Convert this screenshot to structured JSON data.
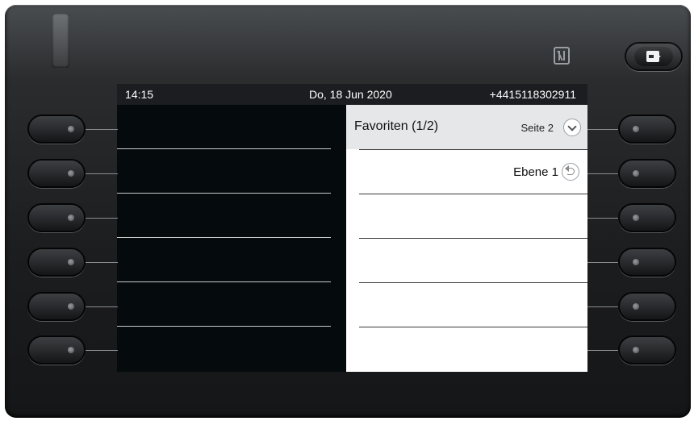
{
  "status_bar": {
    "time": "14:15",
    "date": "Do, 18 Jun 2020",
    "phone_number": "+4415118302911"
  },
  "favorites": {
    "title": "Favoriten (1/2)",
    "page_label": "Seite 2",
    "level_label": "Ebene 1"
  },
  "icons": {
    "nfc": "nfc-icon",
    "logout": "logout-icon",
    "page_next": "chevron-down-icon",
    "level_back": "back-arrow-icon"
  },
  "colors": {
    "screen_background": "#050a0d",
    "status_bar": "#1b1d20",
    "panel_header": "#e6e7e8"
  }
}
